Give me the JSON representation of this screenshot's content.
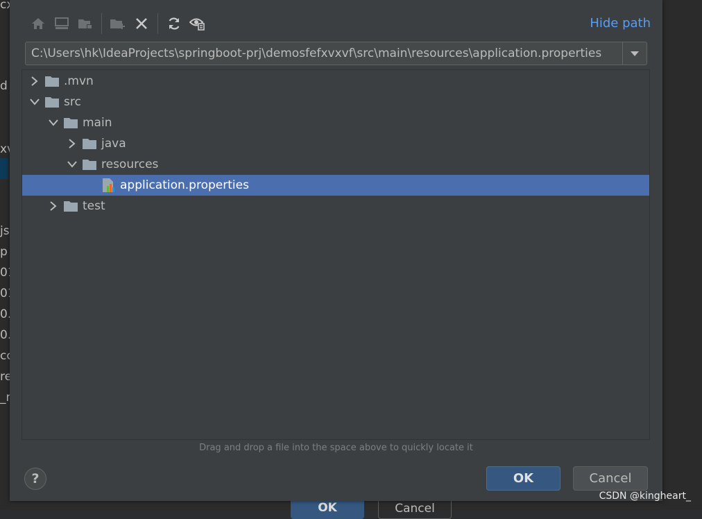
{
  "background": {
    "left_fragments": [
      "cx",
      "d",
      "xv",
      "js",
      "p",
      "01",
      "01",
      "0.",
      "0.",
      "cc",
      "re",
      "_n"
    ],
    "ghost_buttons": {
      "ok": "OK",
      "cancel": "Cancel"
    }
  },
  "toolbar": {
    "icons": [
      "home-icon",
      "desktop-icon",
      "project-folder-icon",
      "new-folder-icon",
      "delete-icon",
      "refresh-icon",
      "show-hidden-icon"
    ],
    "hide_path_label": "Hide path"
  },
  "path": {
    "value": "C:\\Users\\hk\\IdeaProjects\\springboot-prj\\demosfefxvxvf\\src\\main\\resources\\application.properties"
  },
  "tree": {
    "rows": [
      {
        "label": ".mvn",
        "depth": 0,
        "expanded": false,
        "type": "folder",
        "selected": false
      },
      {
        "label": "src",
        "depth": 0,
        "expanded": true,
        "type": "folder",
        "selected": false
      },
      {
        "label": "main",
        "depth": 1,
        "expanded": true,
        "type": "folder",
        "selected": false
      },
      {
        "label": "java",
        "depth": 2,
        "expanded": false,
        "type": "folder",
        "selected": false
      },
      {
        "label": "resources",
        "depth": 2,
        "expanded": true,
        "type": "folder",
        "selected": false
      },
      {
        "label": "application.properties",
        "depth": 3,
        "expanded": null,
        "type": "properties-file",
        "selected": true
      },
      {
        "label": "test",
        "depth": 1,
        "expanded": false,
        "type": "folder",
        "selected": false
      }
    ]
  },
  "hint": "Drag and drop a file into the space above to quickly locate it",
  "buttons": {
    "help": "?",
    "ok": "OK",
    "cancel": "Cancel"
  },
  "watermark": "CSDN @kingheart_",
  "colors": {
    "accent": "#589df6",
    "selection": "#4b6eaf",
    "primary_button": "#365880"
  }
}
